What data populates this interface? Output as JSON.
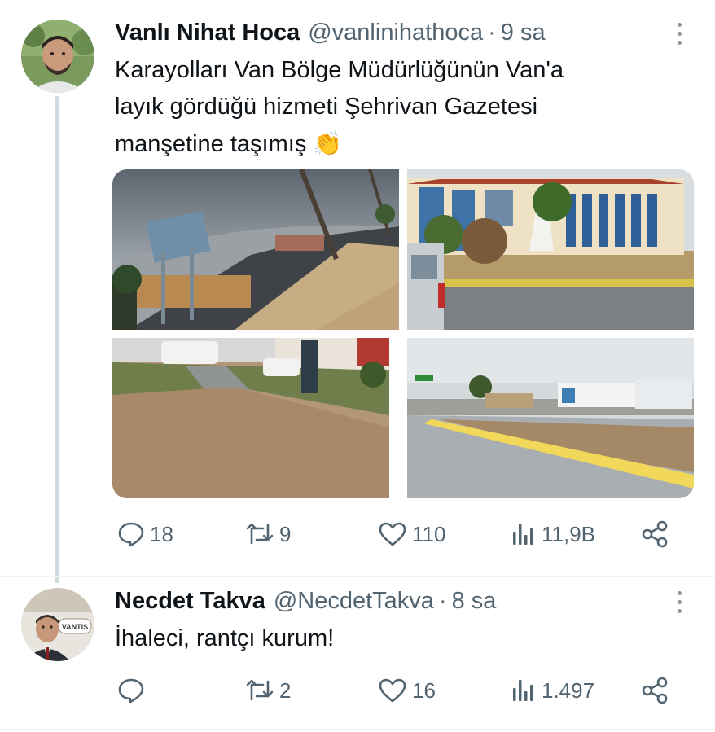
{
  "tweet1": {
    "name": "Vanlı Nihat Hoca",
    "handle": "@vanlinihathoca",
    "separator": "·",
    "time": "9 sa",
    "text_line1": "Karayolları Van Bölge Müdürlüğünün Van'a",
    "text_line2": "layık gördüğü hizmeti Şehrivan Gazetesi",
    "text_line3": "manşetine taşımış",
    "emoji": "👏",
    "photos": [
      "roadside-billboard-photo",
      "government-building-photo",
      "broken-sidewalk-photo",
      "highway-trucks-photo"
    ],
    "replies": "18",
    "reposts": "9",
    "likes": "110",
    "views": "11,9B"
  },
  "tweet2": {
    "name": "Necdet Takva",
    "handle": "@NecdetTakva",
    "separator": "·",
    "time": "8 sa",
    "text": "İhaleci, rantçı kurum!",
    "avatar_logo_text": "VANTIS",
    "replies": "",
    "reposts": "2",
    "likes": "16",
    "views": "1.497"
  },
  "colors": {
    "text": "#0f1419",
    "secondary": "#536471",
    "thread_line": "#cfd9de",
    "divider": "#eff3f4"
  },
  "icons": [
    "reply-icon",
    "repost-icon",
    "like-icon",
    "views-icon",
    "share-icon",
    "more-options-icon"
  ]
}
